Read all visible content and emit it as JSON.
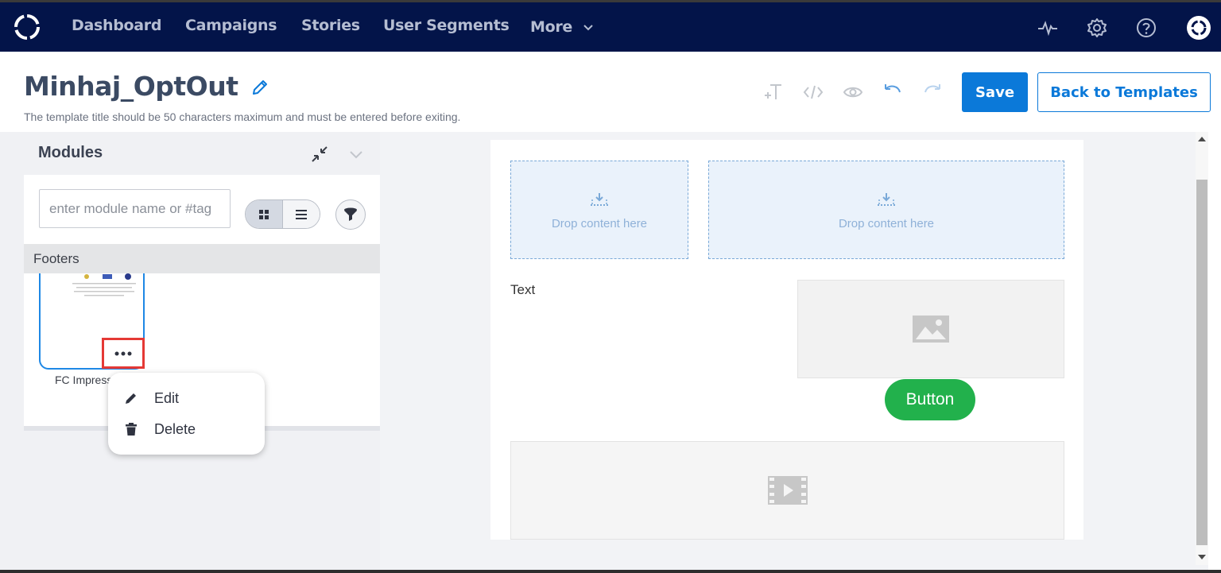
{
  "nav": {
    "items": [
      "Dashboard",
      "Campaigns",
      "Stories",
      "User Segments",
      "More"
    ],
    "icons": [
      "activity-icon",
      "gear-icon",
      "help-icon",
      "account-icon"
    ]
  },
  "header": {
    "title": "Minhaj_OptOut",
    "hint": "The template title should be 50 characters maximum and must be entered before exiting.",
    "save_label": "Save",
    "back_label": "Back to Templates"
  },
  "sidebar": {
    "title": "Modules",
    "search_placeholder": "enter module name or #tag",
    "category": "Footers",
    "card_label": "FC Impress",
    "menu": {
      "edit_label": "Edit",
      "delete_label": "Delete"
    }
  },
  "canvas": {
    "drop_label_1": "Drop content here",
    "drop_label_2": "Drop content here",
    "text_label": "Text",
    "button_label": "Button"
  },
  "colors": {
    "nav_bg": "#031449",
    "primary": "#0b79d9",
    "button_green": "#22b14c",
    "highlight_red": "#e53935"
  }
}
